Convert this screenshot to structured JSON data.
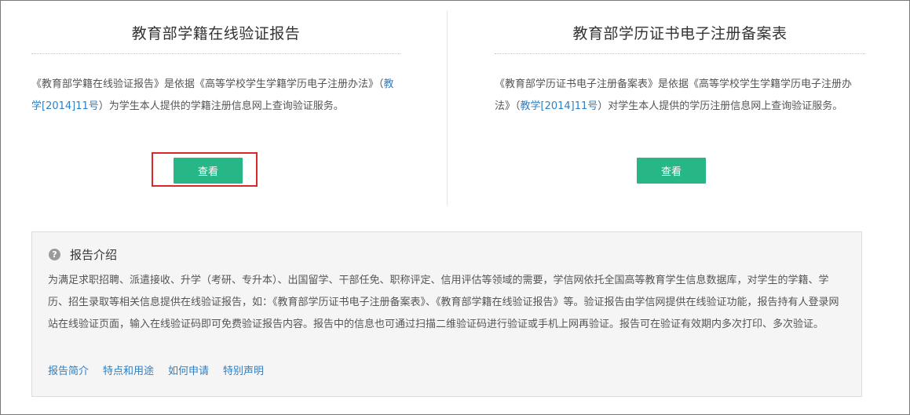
{
  "cards": {
    "left": {
      "title": "教育部学籍在线验证报告",
      "desc_before": "《教育部学籍在线验证报告》是依据《高等学校学生学籍学历电子注册办法》（",
      "desc_link": "教学[2014]11号",
      "desc_after": "）为学生本人提供的学籍注册信息网上查询验证服务。",
      "button_label": "查看"
    },
    "right": {
      "title": "教育部学历证书电子注册备案表",
      "desc_before": "《教育部学历证书电子注册备案表》是依据《高等学校学生学籍学历电子注册办法》（",
      "desc_link": "教学[2014]11号",
      "desc_after": "）对学生本人提供的学历注册信息网上查询验证服务。",
      "button_label": "查看"
    }
  },
  "intro": {
    "icon": "question-circle-icon",
    "title": "报告介绍",
    "body": "为满足求职招聘、派遣接收、升学（考研、专升本）、出国留学、干部任免、职称评定、信用评估等领域的需要，学信网依托全国高等教育学生信息数据库，对学生的学籍、学历、招生录取等相关信息提供在线验证报告，如：《教育部学历证书电子注册备案表》、《教育部学籍在线验证报告》等。验证报告由学信网提供在线验证功能，报告持有人登录网站在线验证页面，输入在线验证码即可免费验证报告内容。报告中的信息也可通过扫描二维验证码进行验证或手机上网再验证。报告可在验证有效期内多次打印、多次验证。",
    "links": [
      "报告简介",
      "特点和用途",
      "如何申请",
      "特别声明"
    ]
  },
  "colors": {
    "button_green": "#27b787",
    "link_blue": "#2f7fc1",
    "highlight_red": "#d9272e"
  }
}
